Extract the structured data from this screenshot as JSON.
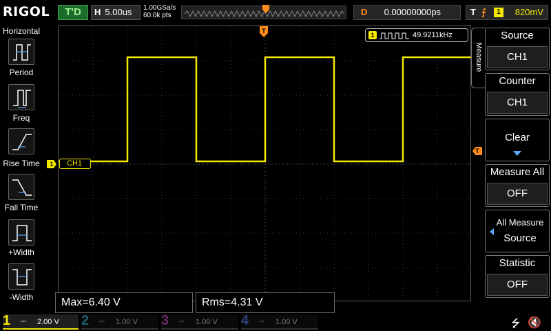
{
  "top": {
    "brand": "RIGOL",
    "run_status": "T'D",
    "horizontal_label": "H",
    "timebase": "5.00us",
    "sample_rate": "1.00GSa/s",
    "mem_depth": "60.0k pts",
    "delay_label": "D",
    "delay_value": "0.00000000ps",
    "trigger_label": "T",
    "trigger_channel": "1",
    "trigger_level": "820mV"
  },
  "left_panel": {
    "title": "Horizontal",
    "items": [
      {
        "label": "Period",
        "icon": "period-icon"
      },
      {
        "label": "Freq",
        "icon": "freq-icon"
      },
      {
        "label": "Rise Time",
        "icon": "rise-time-icon"
      },
      {
        "label": "Fall Time",
        "icon": "fall-time-icon"
      },
      {
        "label": "+Width",
        "icon": "pos-width-icon"
      },
      {
        "label": "-Width",
        "icon": "neg-width-icon"
      }
    ]
  },
  "waveform": {
    "channel_tag": "CH1",
    "channel_marker": "1",
    "trigger_level_marker": "T",
    "trigger_position_marker": "T",
    "color": "#f5e900"
  },
  "counter": {
    "channel": "1",
    "value": "49.9211kHz"
  },
  "measurements": {
    "max": "Max=6.40 V",
    "rms": "Rms=4.31 V"
  },
  "right_menu": {
    "tab_label": "Measure",
    "source": {
      "title": "Source",
      "value": "CH1"
    },
    "counter": {
      "title": "Counter",
      "value": "CH1"
    },
    "clear": {
      "title": "Clear"
    },
    "measure_all": {
      "title": "Measure All",
      "value": "OFF"
    },
    "all_measure_source": {
      "title1": "All Measure",
      "title2": "Source"
    },
    "statistic": {
      "title": "Statistic",
      "value": "OFF"
    }
  },
  "bottom": {
    "channels": [
      {
        "num": "1",
        "scale": "2.00 V",
        "active": true,
        "color": "#f5e900"
      },
      {
        "num": "2",
        "scale": "1.00 V",
        "active": false,
        "color": "#1fb8c8"
      },
      {
        "num": "3",
        "scale": "1.00 V",
        "active": false,
        "color": "#d040d0"
      },
      {
        "num": "4",
        "scale": "1.00 V",
        "active": false,
        "color": "#2a6cff"
      }
    ]
  }
}
